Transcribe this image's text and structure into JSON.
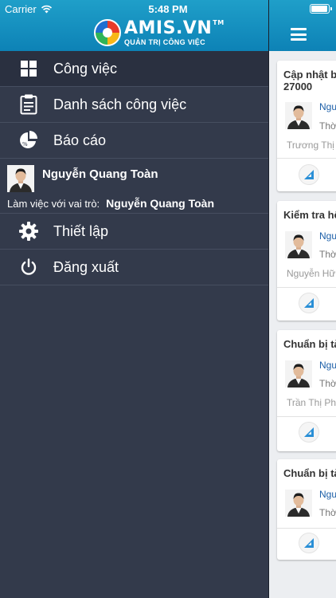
{
  "status_bar": {
    "carrier": "Carrier",
    "time": "5:48 PM",
    "battery_level": 1.0
  },
  "logo": {
    "brand": "AMIS.VN",
    "trademark": "TM",
    "tagline": "QUẢN TRỊ CÔNG VIỆC"
  },
  "menu": {
    "items": [
      {
        "label": "Công việc",
        "icon": "grid-icon"
      },
      {
        "label": "Danh sách công việc",
        "icon": "clipboard-icon"
      },
      {
        "label": "Báo cáo",
        "icon": "pie-chart-icon"
      }
    ],
    "user": {
      "name": "Nguyễn Quang Toàn",
      "role_label": "Làm việc với vai trò:",
      "role_value": "Nguyễn Quang Toàn"
    },
    "settings_label": "Thiết lập",
    "logout_label": "Đăng xuất"
  },
  "tasks": [
    {
      "title": "Cập nhật b",
      "title_line2": "27000",
      "assignee": "Ngu",
      "time": "Thờ",
      "owner": "Trương Thị"
    },
    {
      "title": "Kiểm tra hệ",
      "assignee": "Ngu",
      "time": "Thờ",
      "owner": "Nguyễn Hữ"
    },
    {
      "title": "Chuẩn bị tà",
      "assignee": "Ngu",
      "time": "Thờ",
      "owner": "Trần Thị Ph"
    },
    {
      "title": "Chuẩn bị tà",
      "assignee": "Ngu",
      "time": "Thờ"
    }
  ],
  "colors": {
    "header": "#1496c4",
    "drawer": "#333a4b",
    "active_item": "#2a3040",
    "link": "#1c5fa8"
  }
}
